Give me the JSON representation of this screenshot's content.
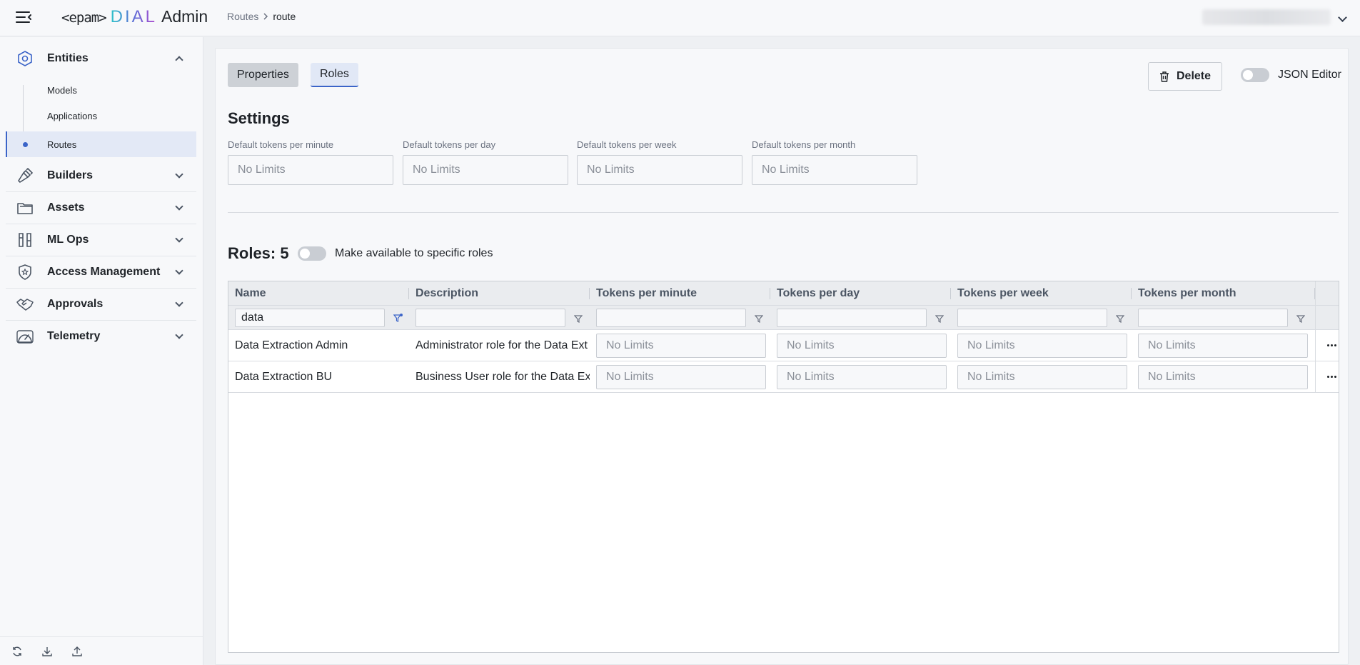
{
  "header": {
    "logo_brand": "<epam>",
    "logo_product": "DIAL",
    "logo_suffix": "Admin",
    "breadcrumb": [
      "Routes",
      "route"
    ]
  },
  "sidebar": {
    "sections": [
      {
        "label": "Entities",
        "expanded": true,
        "icon": "hexagon-icon"
      },
      {
        "label": "Builders",
        "expanded": false,
        "icon": "hammer-icon"
      },
      {
        "label": "Assets",
        "expanded": false,
        "icon": "folder-icon"
      },
      {
        "label": "ML Ops",
        "expanded": false,
        "icon": "test-tubes-icon"
      },
      {
        "label": "Access Management",
        "expanded": false,
        "icon": "shield-star-icon"
      },
      {
        "label": "Approvals",
        "expanded": false,
        "icon": "handshake-icon"
      },
      {
        "label": "Telemetry",
        "expanded": false,
        "icon": "gauge-icon"
      }
    ],
    "entities_items": [
      "Models",
      "Applications",
      "Routes"
    ],
    "active_item": "Routes",
    "bottom_icons": [
      "refresh-icon",
      "download-icon",
      "upload-icon"
    ]
  },
  "tabs": [
    "Properties",
    "Roles"
  ],
  "active_tab": "Roles",
  "toolbar": {
    "delete_label": "Delete",
    "json_editor_label": "JSON Editor",
    "json_editor_enabled": false
  },
  "settings": {
    "title": "Settings",
    "fields": [
      {
        "label": "Default tokens per minute",
        "placeholder": "No Limits"
      },
      {
        "label": "Default tokens per day",
        "placeholder": "No Limits"
      },
      {
        "label": "Default tokens per week",
        "placeholder": "No Limits"
      },
      {
        "label": "Default tokens per month",
        "placeholder": "No Limits"
      }
    ]
  },
  "roles": {
    "title": "Roles: 5",
    "toggle_label": "Make available to specific roles",
    "toggle_enabled": false,
    "columns": [
      "Name",
      "Description",
      "Tokens per minute",
      "Tokens per day",
      "Tokens per week",
      "Tokens per month"
    ],
    "filters": [
      "data",
      "",
      "",
      "",
      "",
      ""
    ],
    "rows": [
      {
        "name": "Data Extraction Admin",
        "description": "Administrator role for the Data Ext",
        "minute": "No Limits",
        "day": "No Limits",
        "week": "No Limits",
        "month": "No Limits"
      },
      {
        "name": "Data Extraction BU",
        "description": "Business User role for the Data Ex",
        "minute": "No Limits",
        "day": "No Limits",
        "week": "No Limits",
        "month": "No Limits"
      }
    ]
  },
  "colors": {
    "accent": "#3b64c8",
    "active_tab_bg": "#e1e8f6",
    "sidebar_active_bg": "#e3e9f6"
  }
}
